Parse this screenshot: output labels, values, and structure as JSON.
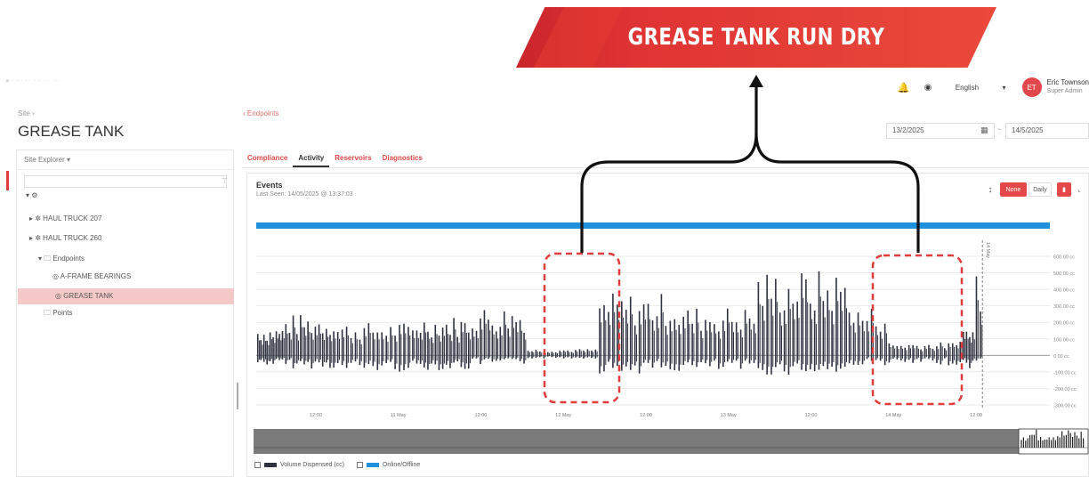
{
  "banner": {
    "text": "GREASE TANK RUN DRY"
  },
  "header": {
    "faint": "● · ··· ·· ···· ··· ···",
    "language": "English",
    "avatar_initials": "ET",
    "user_name": "Eric Townson",
    "user_role": "Super Admin"
  },
  "breadcrumb": {
    "site": "Site ›",
    "endpoints": "‹ Endpoints"
  },
  "page_title": "GREASE TANK",
  "date_range": {
    "from": "13/2/2025",
    "separator": "~",
    "to": "14/5/2025"
  },
  "explorer": {
    "title": "Site Explorer ▾",
    "items": [
      {
        "label": "▾ ⚙",
        "indent": 0
      },
      {
        "label": "▸ ✲ HAUL TRUCK 207",
        "indent": 1
      },
      {
        "label": "▸ ✲ HAUL TRUCK 260",
        "indent": 1
      },
      {
        "label": "▾ 🗀 Endpoints",
        "indent": 2
      },
      {
        "label": "◎ A-FRAME BEARINGS",
        "indent": 3
      },
      {
        "label": "◎ GREASE TANK",
        "indent": 3,
        "selected": true
      },
      {
        "label": "🗀 Points",
        "indent": 2
      }
    ]
  },
  "tabs": [
    "Compliance",
    "Activity",
    "Reservoirs",
    "Diagnostics"
  ],
  "active_tab": "Activity",
  "events": {
    "title": "Events",
    "last_seen": "Last Seen: 14/05/2025 @ 13:37:03",
    "btn_none": "None",
    "btn_daily": "Daily"
  },
  "colors": {
    "accent": "#e44848",
    "online_bar": "#1e90dc",
    "series": "#2d3140",
    "highlight": "#e03c3c"
  },
  "chart_data": {
    "type": "bar",
    "yticks": [
      "600.00 cc",
      "500.00 cc",
      "400.00 cc",
      "300.00 cc",
      "200.00 cc",
      "100.00 cc",
      "0.00 cc",
      "-100.00 cc",
      "-200.00 cc",
      "-300.00 cc"
    ],
    "ylim": [
      -300,
      600
    ],
    "xticks": [
      "12:00",
      "11 May",
      "12:00",
      "12 May",
      "12:00",
      "13 May",
      "12:00",
      "14 May",
      "12:00"
    ],
    "marker_label": "14 May",
    "series": [
      {
        "name": "Volume Dispensed (cc)",
        "pattern": [
          {
            "seg": [
              0.0,
              0.035
            ],
            "hi": 180,
            "lo": -60,
            "n": 9
          },
          {
            "seg": [
              0.035,
              0.1
            ],
            "hi": 250,
            "lo": -80,
            "n": 14
          },
          {
            "seg": [
              0.1,
              0.2
            ],
            "hi": 200,
            "lo": -100,
            "n": 18
          },
          {
            "seg": [
              0.2,
              0.27
            ],
            "hi": 240,
            "lo": -90,
            "n": 15
          },
          {
            "seg": [
              0.27,
              0.34
            ],
            "hi": 300,
            "lo": -60,
            "n": 14
          },
          {
            "seg": [
              0.34,
              0.43
            ],
            "hi": 40,
            "lo": -20,
            "n": 18
          },
          {
            "seg": [
              0.43,
              0.53
            ],
            "hi": 380,
            "lo": -110,
            "n": 18
          },
          {
            "seg": [
              0.53,
              0.63
            ],
            "hi": 300,
            "lo": -100,
            "n": 18
          },
          {
            "seg": [
              0.63,
              0.75
            ],
            "hi": 520,
            "lo": -120,
            "n": 22
          },
          {
            "seg": [
              0.75,
              0.795
            ],
            "hi": 300,
            "lo": -60,
            "n": 8
          },
          {
            "seg": [
              0.795,
              0.885
            ],
            "hi": 80,
            "lo": -60,
            "n": 18
          },
          {
            "seg": [
              0.885,
              0.905
            ],
            "hi": 180,
            "lo": -80,
            "n": 5
          },
          {
            "seg": [
              0.905,
              0.915
            ],
            "hi": 580,
            "lo": -40,
            "n": 2
          }
        ]
      },
      {
        "name": "Online/Offline"
      }
    ]
  },
  "legend": {
    "volume": "Volume Dispensed (cc)",
    "online": "Online/Offline"
  }
}
